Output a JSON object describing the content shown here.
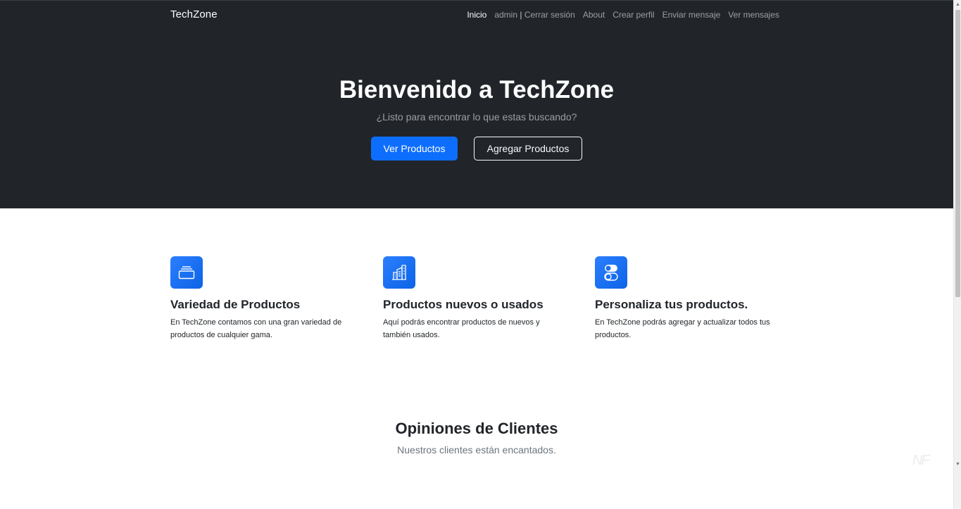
{
  "navbar": {
    "brand": "TechZone",
    "links": {
      "inicio": "Inicio",
      "user": "admin",
      "separator": "|",
      "logout": "Cerrar sesión",
      "about": "About",
      "crear_perfil": "Crear perfil",
      "enviar_mensaje": "Enviar mensaje",
      "ver_mensajes": "Ver mensajes"
    }
  },
  "hero": {
    "title": "Bienvenido a TechZone",
    "subtitle": "¿Listo para encontrar lo que estas buscando?",
    "primary_button": "Ver Productos",
    "secondary_button": "Agregar Productos"
  },
  "features": [
    {
      "icon": "collection-icon",
      "title": "Variedad de Productos",
      "text": "En TechZone contamos con una gran variedad de productos de cualquier gama."
    },
    {
      "icon": "building-icon",
      "title": "Productos nuevos o usados",
      "text": "Aquí podrás encontrar productos de nuevos y también usados."
    },
    {
      "icon": "toggles-icon",
      "title": "Personaliza tus productos.",
      "text": "En TechZone podrás agregar y actualizar todos tus productos."
    }
  ],
  "testimonials": {
    "title": "Opiniones de Clientes",
    "subtitle": "Nuestros clientes están encantados."
  },
  "watermark": "NF",
  "colors": {
    "dark": "#212529",
    "primary": "#0d6efd",
    "muted": "#6c757d"
  }
}
